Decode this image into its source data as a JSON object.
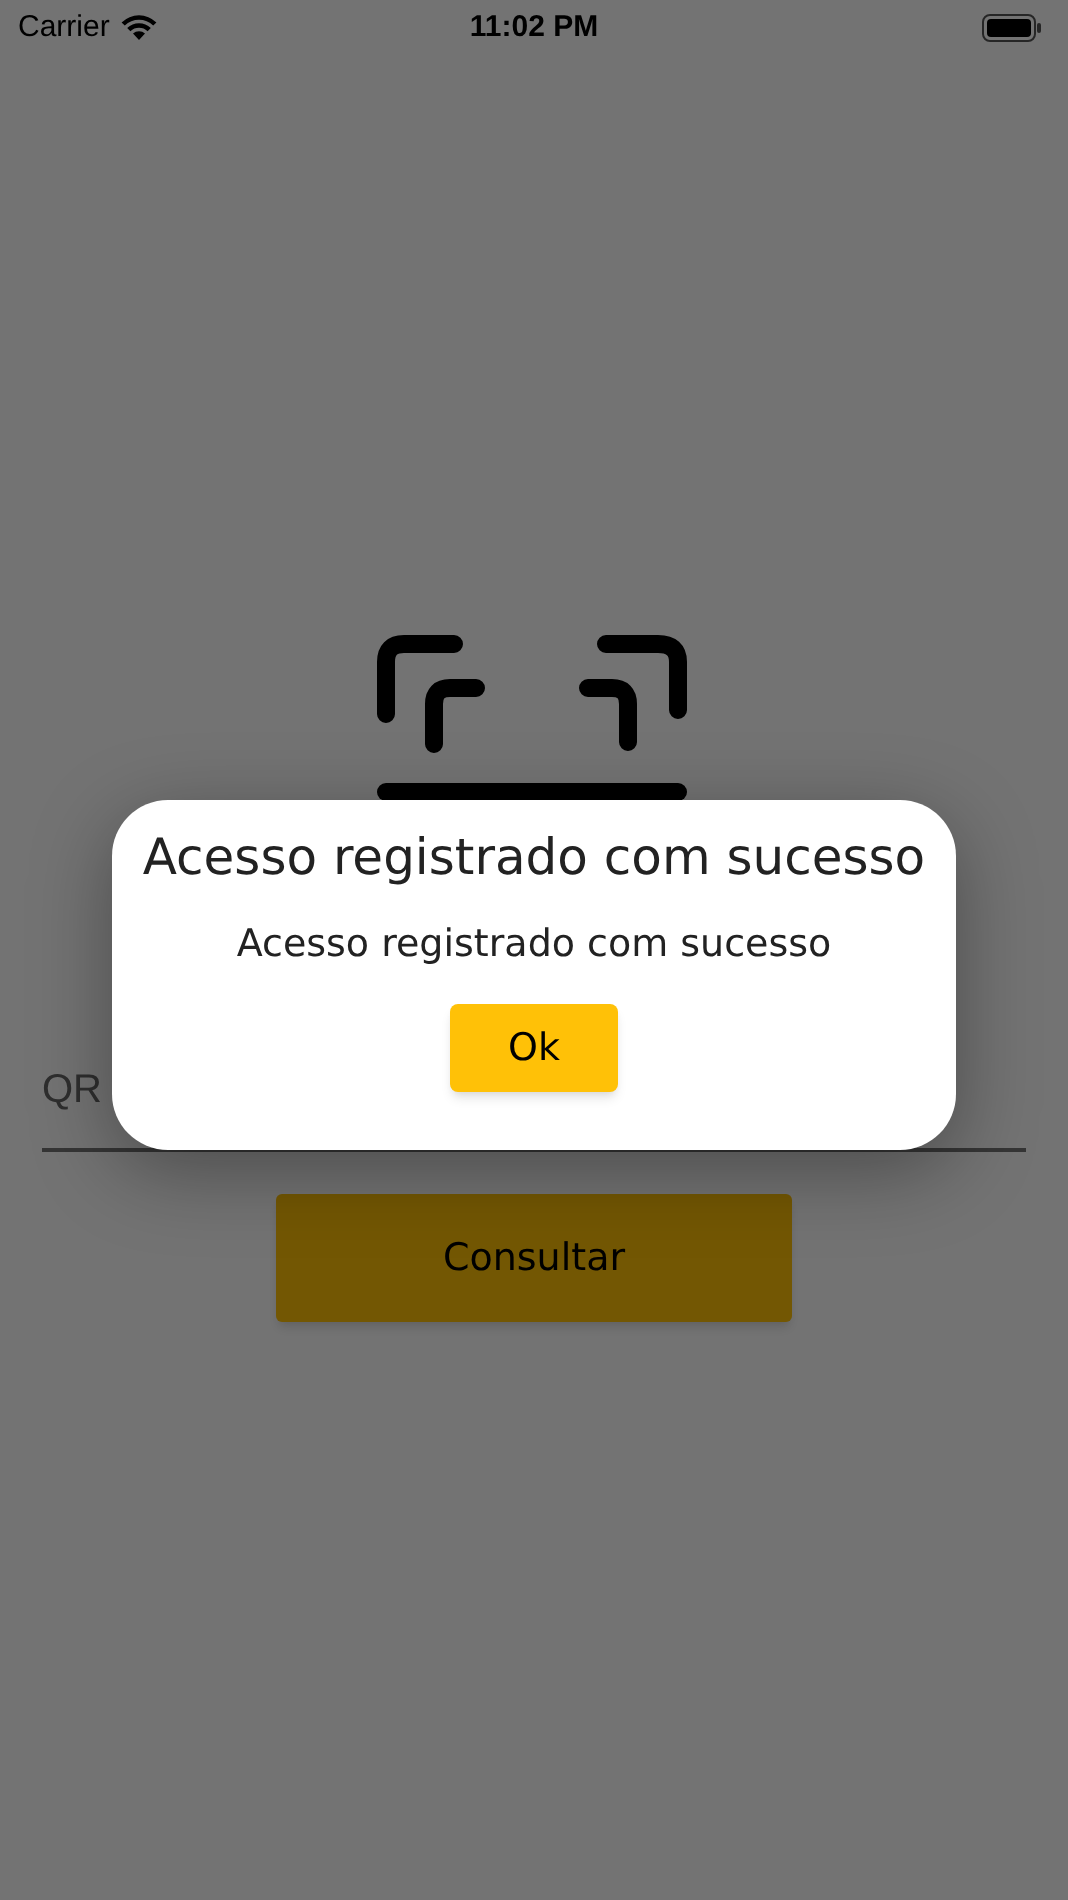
{
  "status_bar": {
    "carrier": "Carrier",
    "time": "11:02 PM"
  },
  "qr_field": {
    "placeholder": "QR"
  },
  "consult_button": {
    "label": "Consultar"
  },
  "dialog": {
    "title": "Acesso registrado com sucesso",
    "message": "Acesso registrado com sucesso",
    "button": "Ok"
  }
}
